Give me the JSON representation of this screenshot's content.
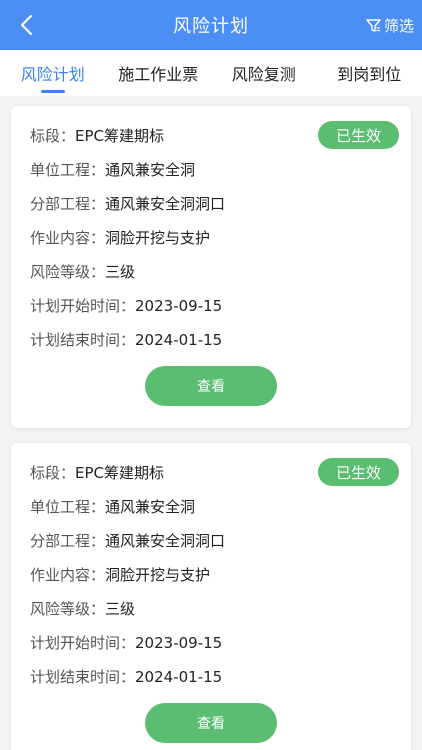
{
  "header": {
    "title": "风险计划",
    "filter_label": "筛选",
    "back_icon": "chevron-left-icon",
    "filter_icon": "funnel-icon",
    "color": "#4b8ff5"
  },
  "tabs": [
    {
      "label": "风险计划",
      "active": true
    },
    {
      "label": "施工作业票",
      "active": false
    },
    {
      "label": "风险复测",
      "active": false
    },
    {
      "label": "到岗到位",
      "active": false
    }
  ],
  "cards": [
    {
      "status": "已生效",
      "fields": [
        {
          "label": "标段：",
          "value": "EPC筹建期标"
        },
        {
          "label": "单位工程：",
          "value": "通风兼安全洞"
        },
        {
          "label": "分部工程：",
          "value": "通风兼安全洞洞口"
        },
        {
          "label": "作业内容：",
          "value": "洞脸开挖与支护"
        },
        {
          "label": "风险等级：",
          "value": "三级"
        },
        {
          "label": "计划开始时间：",
          "value": "2023-09-15"
        },
        {
          "label": "计划结束时间：",
          "value": "2024-01-15"
        }
      ],
      "view_label": "查看"
    },
    {
      "status": "已生效",
      "fields": [
        {
          "label": "标段：",
          "value": "EPC筹建期标"
        },
        {
          "label": "单位工程：",
          "value": "通风兼安全洞"
        },
        {
          "label": "分部工程：",
          "value": "通风兼安全洞洞口"
        },
        {
          "label": "作业内容：",
          "value": "洞脸开挖与支护"
        },
        {
          "label": "风险等级：",
          "value": "三级"
        },
        {
          "label": "计划开始时间：",
          "value": "2023-09-15"
        },
        {
          "label": "计划结束时间：",
          "value": "2024-01-15"
        }
      ],
      "view_label": "查看"
    }
  ],
  "colors": {
    "accent": "#3b82f6",
    "status_green": "#5bbd72"
  }
}
